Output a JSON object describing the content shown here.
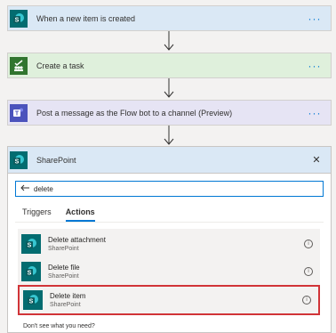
{
  "steps": [
    {
      "title": "When a new item is created",
      "icon": "sharepoint-icon",
      "bg": "#dae8f5"
    },
    {
      "title": "Create a task",
      "icon": "planner-icon",
      "bg": "#dff0dc"
    },
    {
      "title": "Post a message as the Flow bot to a channel (Preview)",
      "icon": "teams-icon",
      "bg": "#e6e4f4"
    }
  ],
  "more_glyph": "···",
  "panel": {
    "title": "SharePoint",
    "close_glyph": "✕",
    "search": {
      "value": "delete"
    },
    "tabs": [
      "Triggers",
      "Actions"
    ],
    "active_tab": "Actions",
    "actions": [
      {
        "name": "Delete attachment",
        "connector": "SharePoint"
      },
      {
        "name": "Delete file",
        "connector": "SharePoint"
      },
      {
        "name": "Delete item",
        "connector": "SharePoint",
        "selected": true
      }
    ],
    "footer": "Don't see what you need?"
  },
  "colors": {
    "sharepoint": "#036c70",
    "planner": "#31752f",
    "teams": "#4b53bc",
    "accent": "#0078d4",
    "selection": "#d13438"
  }
}
